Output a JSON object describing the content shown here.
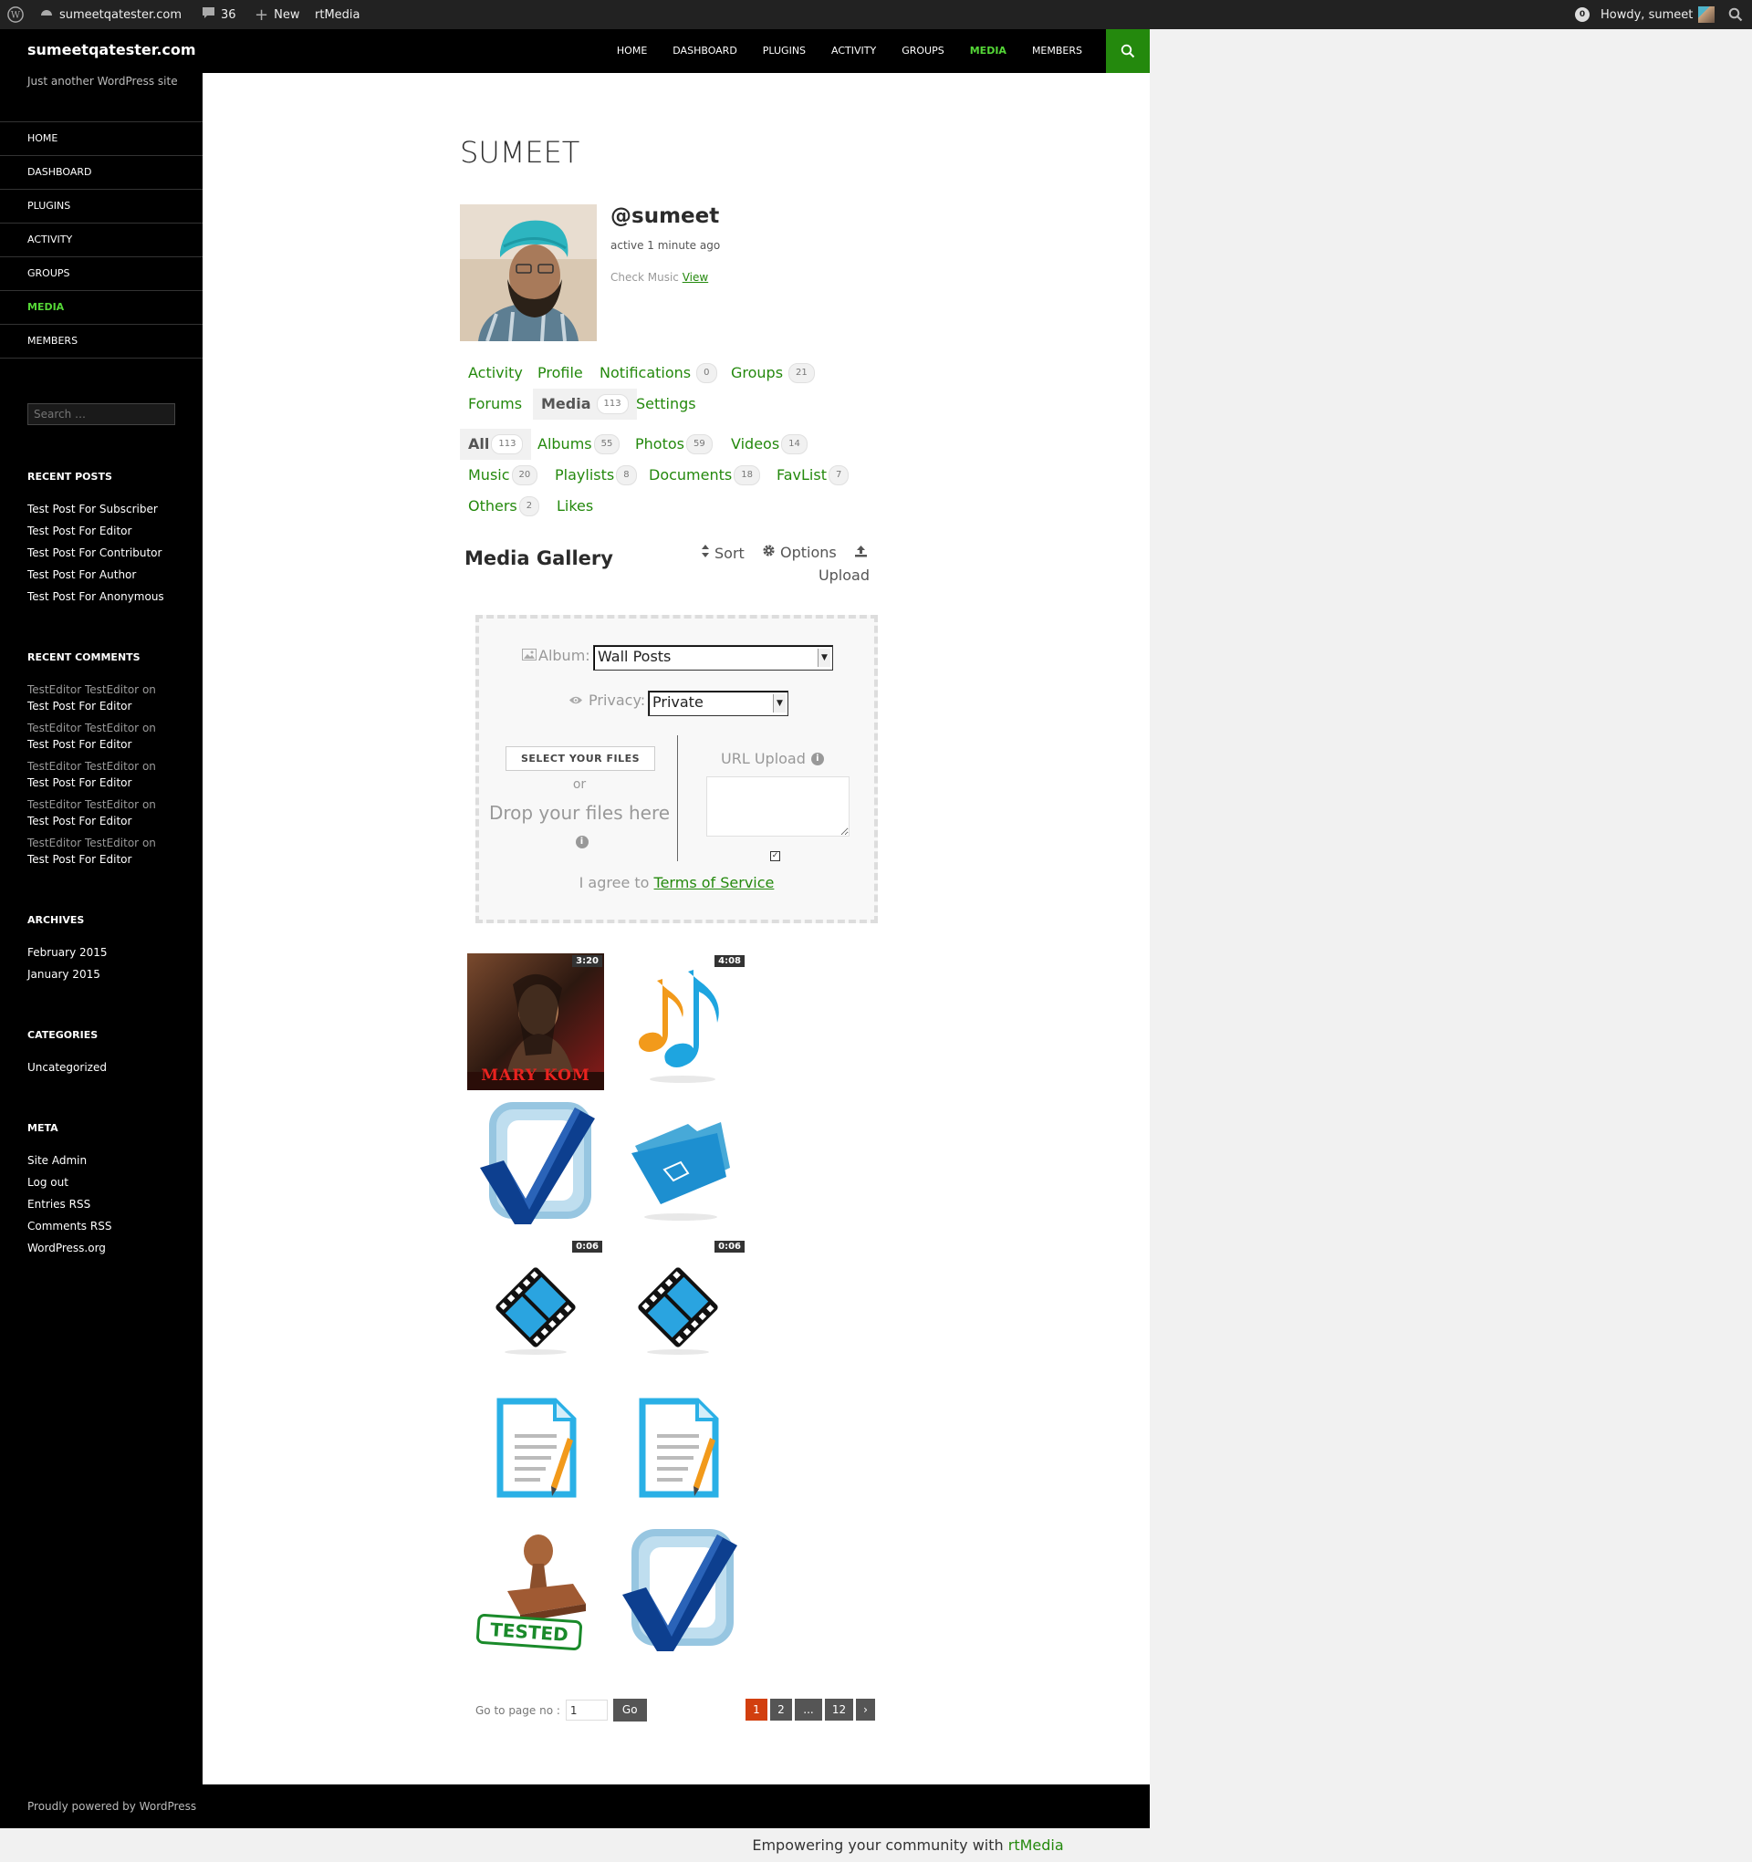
{
  "admin_bar": {
    "site": "sumeetqatester.com",
    "comments_count": "36",
    "new_label": "New",
    "plugin_label": "rtMedia",
    "notification_count": "0",
    "howdy": "Howdy, sumeet"
  },
  "site": {
    "title": "sumeetqatester.com",
    "tagline": "Just another WordPress site"
  },
  "top_nav": [
    "HOME",
    "DASHBOARD",
    "PLUGINS",
    "ACTIVITY",
    "GROUPS",
    "MEDIA",
    "MEMBERS"
  ],
  "side_nav": [
    "HOME",
    "DASHBOARD",
    "PLUGINS",
    "ACTIVITY",
    "GROUPS",
    "MEDIA",
    "MEMBERS"
  ],
  "sidebar": {
    "search_placeholder": "Search …",
    "recent_posts_title": "RECENT POSTS",
    "recent_posts": [
      "Test Post For Subscriber",
      "Test Post For Editor",
      "Test Post For Contributor",
      "Test Post For Author",
      "Test Post For Anonymous"
    ],
    "recent_comments_title": "RECENT COMMENTS",
    "recent_comments": [
      {
        "author": "TestEditor TestEditor",
        "on": "on",
        "post": "Test Post For Editor"
      },
      {
        "author": "TestEditor TestEditor",
        "on": "on",
        "post": "Test Post For Editor"
      },
      {
        "author": "TestEditor TestEditor",
        "on": "on",
        "post": "Test Post For Editor"
      },
      {
        "author": "TestEditor TestEditor",
        "on": "on",
        "post": "Test Post For Editor"
      },
      {
        "author": "TestEditor TestEditor",
        "on": "on",
        "post": "Test Post For Editor"
      }
    ],
    "archives_title": "ARCHIVES",
    "archives": [
      "February 2015",
      "January 2015"
    ],
    "categories_title": "CATEGORIES",
    "categories": [
      "Uncategorized"
    ],
    "meta_title": "META",
    "meta_links": [
      "Site Admin",
      "Log out",
      "Entries RSS",
      "Comments RSS",
      "WordPress.org"
    ]
  },
  "profile": {
    "name": "SUMEET",
    "handle": "@sumeet",
    "activity": "active 1 minute ago",
    "check_music": "Check Music",
    "view_link": "View"
  },
  "profile_tabs": [
    {
      "label": "Activity",
      "count": ""
    },
    {
      "label": "Profile",
      "count": ""
    },
    {
      "label": "Notifications",
      "count": "0"
    },
    {
      "label": "Groups",
      "count": "21"
    },
    {
      "label": "Forums",
      "count": ""
    },
    {
      "label": "Media",
      "count": "113"
    },
    {
      "label": "Settings",
      "count": ""
    }
  ],
  "media_tabs": [
    {
      "label": "All",
      "count": "113"
    },
    {
      "label": "Albums",
      "count": "55"
    },
    {
      "label": "Photos",
      "count": "59"
    },
    {
      "label": "Videos",
      "count": "14"
    },
    {
      "label": "Music",
      "count": "20"
    },
    {
      "label": "Playlists",
      "count": "8"
    },
    {
      "label": "Documents",
      "count": "18"
    },
    {
      "label": "FavList",
      "count": "7"
    },
    {
      "label": "Others",
      "count": "2"
    },
    {
      "label": "Likes",
      "count": ""
    }
  ],
  "gallery": {
    "title": "Media Gallery",
    "sort": "Sort",
    "options": "Options",
    "upload": "Upload"
  },
  "uploader": {
    "album_label": "Album:",
    "album_value": "Wall Posts",
    "privacy_label": "Privacy:",
    "privacy_value": "Private",
    "select_files": "SELECT YOUR FILES",
    "or": "or",
    "drop_text": "Drop your files here",
    "url_upload": "URL Upload",
    "agree_text": "I agree to",
    "terms": "Terms of Service"
  },
  "media_items": [
    {
      "type": "photo",
      "icon": "movie-poster-image",
      "poster_text": "MARY KOM",
      "duration": "3:20"
    },
    {
      "type": "music",
      "icon": "music-note-icon",
      "duration": "4:08"
    },
    {
      "type": "album",
      "icon": "check-mark-icon",
      "duration": ""
    },
    {
      "type": "album",
      "icon": "folder-icon",
      "duration": ""
    },
    {
      "type": "video",
      "icon": "film-strip-icon",
      "duration": "0:06"
    },
    {
      "type": "video",
      "icon": "film-strip-icon",
      "duration": "0:06"
    },
    {
      "type": "document",
      "icon": "document-icon",
      "duration": ""
    },
    {
      "type": "document",
      "icon": "document-icon",
      "duration": ""
    },
    {
      "type": "other",
      "icon": "tested-stamp-icon",
      "stamp_text": "TESTED",
      "duration": ""
    },
    {
      "type": "album",
      "icon": "check-mark-icon",
      "duration": ""
    }
  ],
  "pagination": {
    "go_to_label": "Go to page no :",
    "page_value": "1",
    "go": "Go",
    "pages": [
      "1",
      "2",
      "...",
      "12",
      "›"
    ]
  },
  "footer": {
    "powered": "Proudly powered by WordPress"
  },
  "bottom_bar": {
    "text": "Empowering your community with",
    "brand": "rtMedia"
  },
  "colors": {
    "accent": "#24890d",
    "accent_light": "#55d737",
    "page_current": "#d23f0f",
    "admin_bar": "#222222"
  }
}
